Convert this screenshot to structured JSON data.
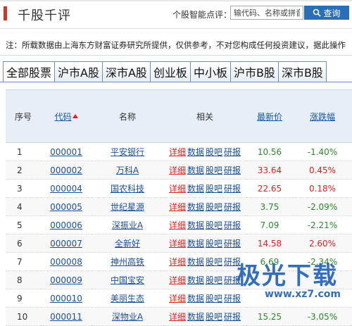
{
  "header": {
    "title": "千股千评",
    "search_label": "个股智能点评：",
    "search_placeholder": "输代码、名称或拼音",
    "search_button": "查询"
  },
  "notice": "注：所载数据由上海东方财富证券研究所提供，仅供参考，不对您构成任何投资建议，据此操作",
  "tabs": [
    "全部股票",
    "沪市A股",
    "深市A股",
    "创业板",
    "中小板",
    "沪市B股",
    "深市B股"
  ],
  "table": {
    "headers": {
      "index": "序号",
      "code": "代码",
      "name": "名称",
      "related": "相关",
      "price": "最新价",
      "change": "涨跌幅"
    },
    "related_links": [
      "详细",
      "数据",
      "股吧",
      "研报"
    ],
    "rows": [
      {
        "index": "1",
        "code": "000001",
        "name": "平安银行",
        "price": "10.56",
        "change": "-1.40%",
        "up": false
      },
      {
        "index": "2",
        "code": "000002",
        "name": "万科A",
        "price": "33.64",
        "change": "0.45%",
        "up": true
      },
      {
        "index": "3",
        "code": "000004",
        "name": "国农科技",
        "price": "22.65",
        "change": "0.18%",
        "up": true
      },
      {
        "index": "4",
        "code": "000005",
        "name": "世纪星源",
        "price": "3.75",
        "change": "-2.09%",
        "up": false
      },
      {
        "index": "5",
        "code": "000006",
        "name": "深振业A",
        "price": "7.09",
        "change": "-2.21%",
        "up": false
      },
      {
        "index": "6",
        "code": "000007",
        "name": "全新好",
        "price": "14.58",
        "change": "2.60%",
        "up": true
      },
      {
        "index": "7",
        "code": "000008",
        "name": "神州高铁",
        "price": "6.69",
        "change": "-2.34%",
        "up": false
      },
      {
        "index": "8",
        "code": "000009",
        "name": "中国宝安",
        "price": "",
        "change": "",
        "up": false
      },
      {
        "index": "9",
        "code": "000010",
        "name": "美丽生态",
        "price": "",
        "change": "",
        "up": false
      },
      {
        "index": "10",
        "code": "000011",
        "name": "深物业A",
        "price": "15.25",
        "change": "-3.05%",
        "up": false
      }
    ]
  },
  "watermark": {
    "text": "极光下载",
    "url": "www.xz7.com"
  },
  "colors": {
    "accent": "#2a6fb5",
    "up": "#dd2222",
    "down": "#2a8a2a",
    "link": "#1a4f9c"
  }
}
